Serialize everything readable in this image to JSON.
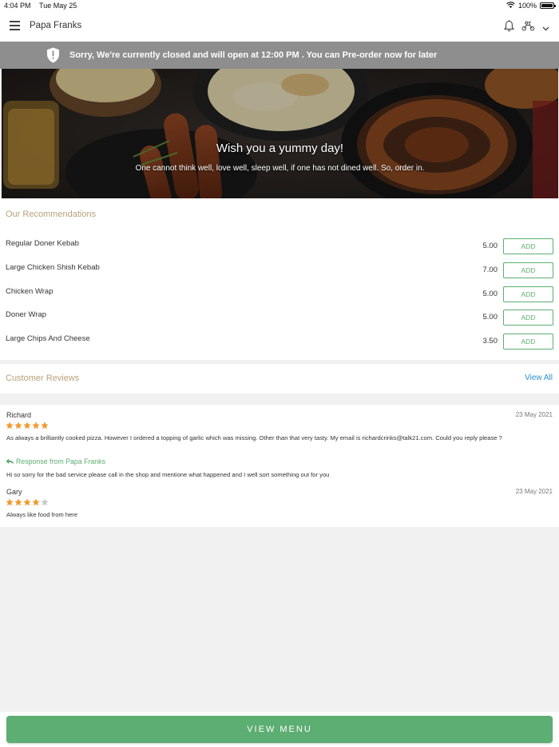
{
  "status_bar": {
    "time": "4:04 PM",
    "date": "Tue May 25",
    "battery": "100%"
  },
  "header": {
    "store_name": "Papa Franks",
    "icons": [
      "menu-icon",
      "bell-icon",
      "scooter-icon",
      "chevron-down-icon"
    ]
  },
  "closed_banner": {
    "text": "Sorry, We're currently closed and will open at 12:00 PM . You can Pre-order now for later",
    "icon": "shield-alert-icon"
  },
  "hero": {
    "title": "Wish you a yummy day!",
    "subtitle": "One cannot think well, love well, sleep well, if one has not dined well. So, order in."
  },
  "recommendations": {
    "title": "Our Recommendations",
    "items": [
      {
        "name": "Regular Doner Kebab",
        "price": "5.00",
        "button": "ADD"
      },
      {
        "name": "Large Chicken Shish Kebab",
        "price": "7.00",
        "button": "ADD"
      },
      {
        "name": "Chicken Wrap",
        "price": "5.00",
        "button": "ADD"
      },
      {
        "name": "Doner Wrap",
        "price": "5.00",
        "button": "ADD"
      },
      {
        "name": "Large Chips And Cheese",
        "price": "3.50",
        "button": "ADD"
      }
    ]
  },
  "reviews": {
    "title": "Customer Reviews",
    "view_all": "View All",
    "items": [
      {
        "name": "Richard",
        "date": "23 May 2021",
        "rating": 5,
        "text": "As always a brilliantly cooked pizza. However I ordered a topping of garlic which was missing. Other than that very tasty. My email is richardcrinks@talk21.com. Could you reply please ?",
        "response_label": "Response from Papa Franks",
        "response_text": "Hi so sorry for the bad service please call in the shop and mentione what happened and I well sort something out for you"
      },
      {
        "name": "Gary",
        "date": "23 May 2021",
        "rating": 4,
        "text": "Always like food from here"
      }
    ],
    "star_colors": {
      "filled": "#f29a2e",
      "empty": "#c9c9c9"
    }
  },
  "footer": {
    "view_menu": "VIEW MENU"
  },
  "colors": {
    "accent_green": "#5cae72",
    "banner_gray": "#8e8e8e",
    "section_title": "#b9a27a",
    "link_blue": "#2a8fc9"
  }
}
